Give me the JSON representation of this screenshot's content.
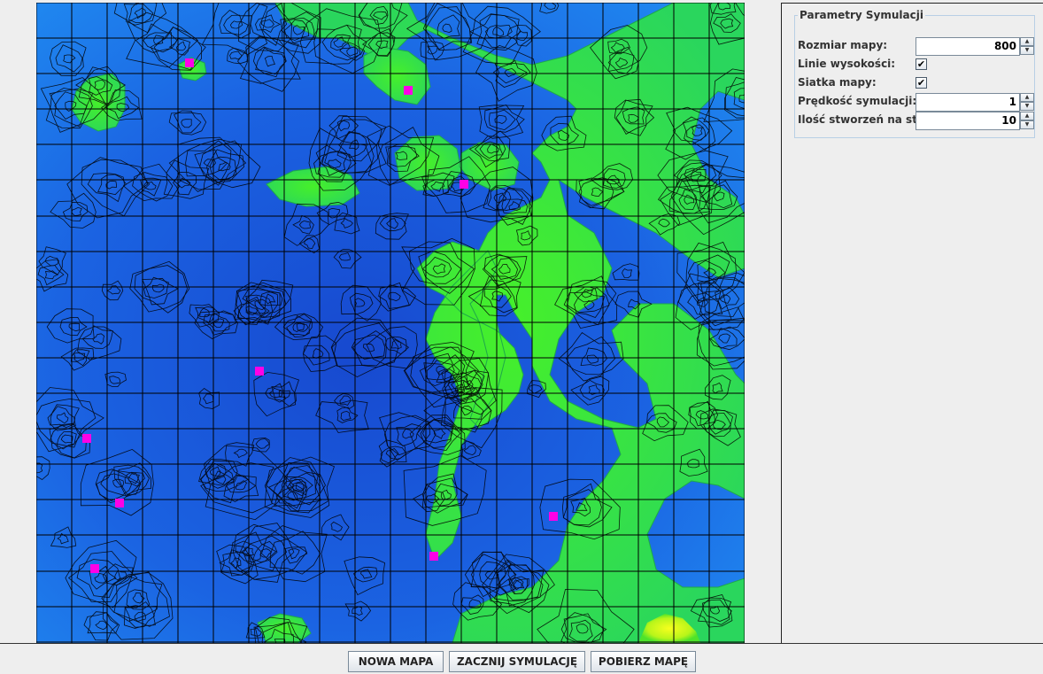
{
  "panel": {
    "title": "Parametry Symulacji",
    "map_size": {
      "label": "Rozmiar mapy:",
      "value": "800"
    },
    "contour_lines": {
      "label": "Linie wysokości:",
      "checked": true
    },
    "map_grid": {
      "label": "Siatka mapy:",
      "checked": true
    },
    "sim_speed": {
      "label": "Prędkość symulacji:",
      "value": "1"
    },
    "creatures": {
      "label": "Ilość stworzeń na start:",
      "value": "10"
    },
    "check_glyph": "✔",
    "spin_up": "▲",
    "spin_down": "▼"
  },
  "buttons": {
    "new_map": "NOWA MAPA",
    "start_sim": "ZACZNIJ SYMULACJĘ",
    "download_map": "POBIERZ MAPĘ"
  },
  "map": {
    "grid_rows": 18,
    "grid_cols": 20,
    "creature_count": 10,
    "colors": {
      "water": "#1d6be6",
      "water_deep": "#1750d2",
      "water_light": "#1f8cf0",
      "land": "#2fd55b",
      "land_high": "#3df02a",
      "peak": "#f4ff20",
      "creature": "#ff00e6",
      "grid": "#000000"
    }
  }
}
